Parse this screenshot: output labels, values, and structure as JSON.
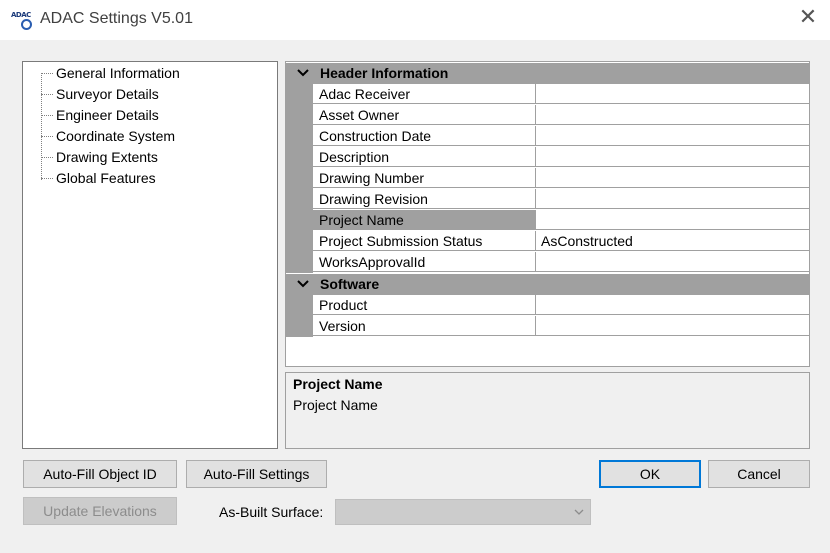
{
  "window": {
    "title": "ADAC Settings V5.01",
    "icon_label": "ADAC",
    "close_glyph": "✕"
  },
  "tree": {
    "items": [
      "General Information",
      "Surveyor Details",
      "Engineer Details",
      "Coordinate System",
      "Drawing Extents",
      "Global Features"
    ]
  },
  "property_grid": {
    "categories": [
      {
        "label": "Header Information",
        "rows": [
          {
            "name": "Adac Receiver",
            "value": ""
          },
          {
            "name": "Asset Owner",
            "value": ""
          },
          {
            "name": "Construction Date",
            "value": ""
          },
          {
            "name": "Description",
            "value": ""
          },
          {
            "name": "Drawing Number",
            "value": ""
          },
          {
            "name": "Drawing Revision",
            "value": ""
          },
          {
            "name": "Project Name",
            "value": "",
            "selected": true
          },
          {
            "name": "Project Submission Status",
            "value": "AsConstructed"
          },
          {
            "name": "WorksApprovalId",
            "value": ""
          }
        ]
      },
      {
        "label": "Software",
        "rows": [
          {
            "name": "Product",
            "value": ""
          },
          {
            "name": "Version",
            "value": ""
          }
        ]
      }
    ]
  },
  "description": {
    "title": "Project Name",
    "body": "Project Name"
  },
  "buttons": {
    "auto_fill_object_id": "Auto-Fill Object ID",
    "auto_fill_settings": "Auto-Fill Settings",
    "ok": "OK",
    "cancel": "Cancel",
    "update_elevations": "Update Elevations"
  },
  "as_built": {
    "label": "As-Built Surface:",
    "selected": ""
  },
  "colors": {
    "grid_category": "#a0a0a0",
    "default_button_border": "#0078d7",
    "window_bg": "#f0f0f0"
  }
}
